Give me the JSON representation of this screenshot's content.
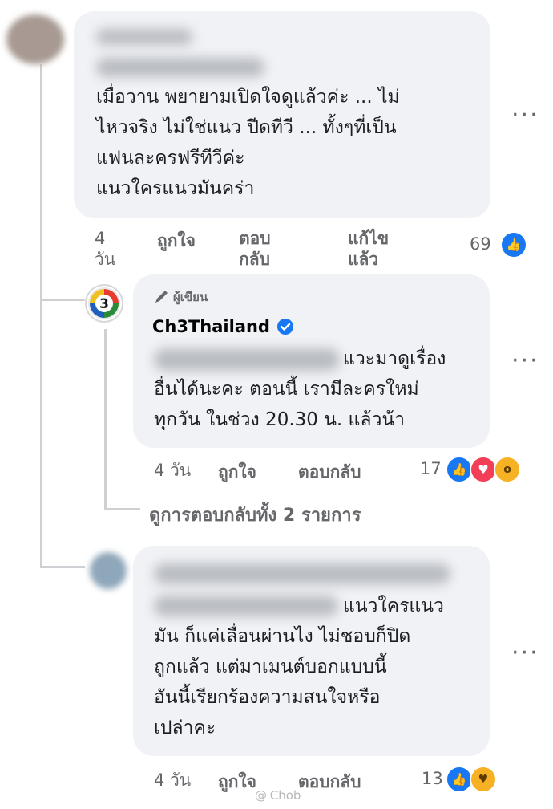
{
  "comment1": {
    "text": "เมื่อวาน พยายามเปิดใจดูแล้วค่ะ ... ไม่\nไหวจริง ไม่ใช่แนว ปีดทีวี ... ทั้งๆที่เป็น\nแฟนละครฟรีทีวีค่ะ\nแนวใครแนวมันคร่า",
    "time_line1": "4",
    "time_line2": "วัน",
    "like_label": "ถูกใจ",
    "reply_line1": "ตอบ",
    "reply_line2": "กลับ",
    "edited_line1": "แก้ไข",
    "edited_line2": "แล้ว",
    "reaction_count": "69"
  },
  "reply1": {
    "author_badge": "ผู้เขียน",
    "author": "Ch3Thailand",
    "text_line1": "แวะมาดูเรื่อง",
    "text_rest": "อื่นได้นะคะ ตอนนี้ เรามีละครใหม่\nทุกวัน ในช่วง 20.30 น. แล้วน้า",
    "time": "4 วัน",
    "like_label": "ถูกใจ",
    "reply_label": "ตอบกลับ",
    "reaction_count": "17"
  },
  "view_replies": "ดูการตอบกลับทั้ง 2 รายการ",
  "comment3": {
    "text_line1": "แนวใครแนว",
    "text_rest": "มัน ก็แค่เลื่อนผ่านไง ไม่ชอบก็ปิด\nถูกแล้ว แต่มาเมนต์บอกแบบนี้\nอันนี้เรียกร้องความสนใจหรือ\nเปล่าคะ",
    "time": "4 วัน",
    "like_label": "ถูกใจ",
    "reply_label": "ตอบกลับ",
    "reaction_count": "13"
  },
  "more_label": "···",
  "watermark": "@ Chob",
  "icons": {
    "like": "like-reaction-icon",
    "love": "love-reaction-icon",
    "wow": "wow-reaction-icon",
    "care": "care-reaction-icon",
    "verified": "verified-badge-icon",
    "pen": "pen-icon"
  },
  "colors": {
    "bubble": "#f0f2f5",
    "like": "#1877f2",
    "love": "#f33e58",
    "wow": "#f7b125",
    "meta": "#65676b"
  }
}
